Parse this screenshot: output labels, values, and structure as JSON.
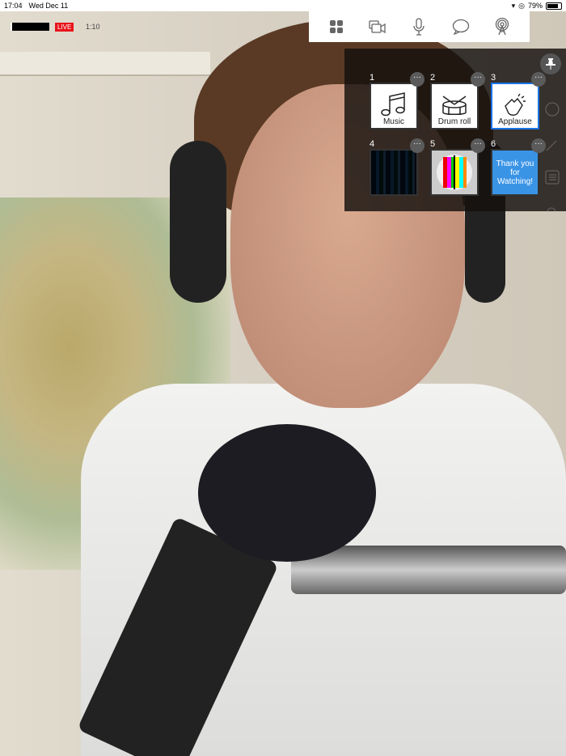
{
  "status_bar": {
    "time": "17:04",
    "date": "Wed Dec 11",
    "battery": "79%",
    "battery_level": 0.79
  },
  "top_bar": {
    "live_label": "LIVE",
    "timer": "1:10"
  },
  "toolbar": {
    "icons": [
      "grid-icon",
      "camera-switch-icon",
      "microphone-icon",
      "chat-icon",
      "broadcast-icon"
    ]
  },
  "panel": {
    "slots": [
      {
        "number": "1",
        "label": "Music",
        "icon": "music-note-icon",
        "selected": false
      },
      {
        "number": "2",
        "label": "Drum roll",
        "icon": "drum-icon",
        "selected": false
      },
      {
        "number": "3",
        "label": "Applause",
        "icon": "clapping-hands-icon",
        "selected": true
      },
      {
        "number": "4",
        "label": "",
        "icon": "video-wall-image",
        "selected": false
      },
      {
        "number": "5",
        "label": "",
        "icon": "test-pattern-image",
        "selected": false
      },
      {
        "number": "6",
        "label": "Thank you for Watching!",
        "icon": "",
        "selected": false
      }
    ],
    "more_label": "···"
  },
  "colors": {
    "live": "#e8141b",
    "selected": "#1a73e8",
    "tile6": "#3a94e6"
  }
}
